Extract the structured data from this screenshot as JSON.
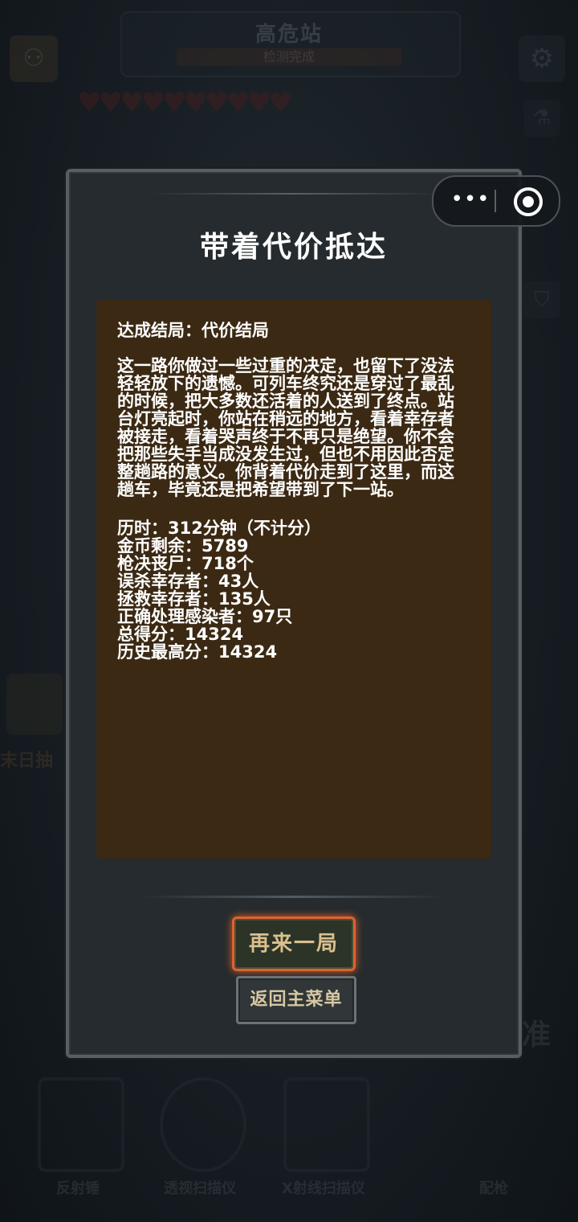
{
  "background": {
    "station_title": "高危站",
    "station_status": "检测完成",
    "left_tag": "末日抽",
    "right_tag": "准",
    "tools": [
      "反射锤",
      "透视扫描仪",
      "X射线扫描仪",
      "配枪"
    ]
  },
  "capsule": {
    "more_glyph": "•••"
  },
  "modal": {
    "title": "带着代价抵达",
    "ending_line": "达成结局：代价结局",
    "story": "这一路你做过一些过重的决定，也留下了没法轻轻放下的遗憾。可列车终究还是穿过了最乱的时候，把大多数还活着的人送到了终点。站台灯亮起时，你站在稍远的地方，看着幸存者被接走，看着哭声终于不再只是绝望。你不会把那些失手当成没发生过，但也不用因此否定整趟路的意义。你背着代价走到了这里，而这趟车，毕竟还是把希望带到了下一站。",
    "stats": [
      "历时：312分钟（不计分）",
      "金币剩余：5789",
      "枪决丧尸：718个",
      "误杀幸存者：43人",
      "拯救幸存者：135人",
      "正确处理感染者：97只",
      "总得分：14324",
      "历史最高分：14324"
    ],
    "play_again_label": "再来一局",
    "main_menu_label": "返回主菜单"
  },
  "colors": {
    "accent_border": "#e0612e",
    "content_bg": "#3b2913",
    "modal_bg": "#252b2e"
  }
}
